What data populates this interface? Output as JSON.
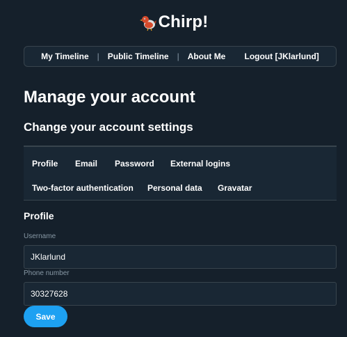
{
  "brand": {
    "title": "Chirp!",
    "icon": "bird-icon"
  },
  "nav": {
    "items": [
      {
        "label": "My Timeline"
      },
      {
        "label": "Public Timeline"
      },
      {
        "label": "About Me"
      },
      {
        "label": "Logout [JKlarlund]"
      }
    ],
    "separator": "|"
  },
  "page": {
    "title": "Manage your account",
    "subtitle": "Change your account settings"
  },
  "tabs": [
    {
      "label": "Profile",
      "active": true
    },
    {
      "label": "Email"
    },
    {
      "label": "Password"
    },
    {
      "label": "External logins"
    },
    {
      "label": "Two-factor authentication"
    },
    {
      "label": "Personal data"
    },
    {
      "label": "Gravatar"
    }
  ],
  "profile": {
    "section_title": "Profile",
    "username_label": "Username",
    "username_value": "JKlarlund",
    "phone_label": "Phone number",
    "phone_value": "30327628",
    "save_label": "Save"
  },
  "colors": {
    "background": "#15202b",
    "panel": "#192734",
    "border": "#38444d",
    "accent": "#1da1f2",
    "muted_text": "#8899a6"
  }
}
